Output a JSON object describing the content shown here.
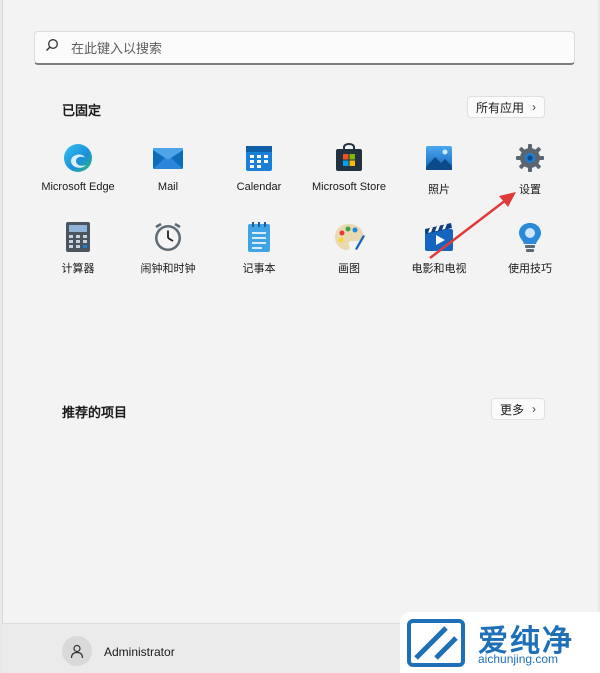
{
  "search": {
    "placeholder": "在此键入以搜索",
    "icon": "search-icon"
  },
  "pinned": {
    "title": "已固定",
    "all_apps_label": "所有应用",
    "apps": [
      {
        "label": "Microsoft Edge",
        "icon": "edge-icon"
      },
      {
        "label": "Mail",
        "icon": "mail-icon"
      },
      {
        "label": "Calendar",
        "icon": "calendar-icon"
      },
      {
        "label": "Microsoft Store",
        "icon": "store-icon"
      },
      {
        "label": "照片",
        "icon": "photos-icon"
      },
      {
        "label": "设置",
        "icon": "settings-gear-icon"
      },
      {
        "label": "计算器",
        "icon": "calculator-icon"
      },
      {
        "label": "闹钟和时钟",
        "icon": "alarm-clock-icon"
      },
      {
        "label": "记事本",
        "icon": "notepad-icon"
      },
      {
        "label": "画图",
        "icon": "paint-palette-icon"
      },
      {
        "label": "电影和电视",
        "icon": "movies-tv-icon"
      },
      {
        "label": "使用技巧",
        "icon": "tips-lightbulb-icon"
      }
    ]
  },
  "recommended": {
    "title": "推荐的项目",
    "more_label": "更多"
  },
  "user": {
    "name": "Administrator"
  },
  "watermark": {
    "big": "爱纯净",
    "small": "aichunjing.com"
  },
  "colors": {
    "accent": "#0078d4",
    "arrow": "#e03a3a",
    "watermark": "#1d6fb8"
  }
}
